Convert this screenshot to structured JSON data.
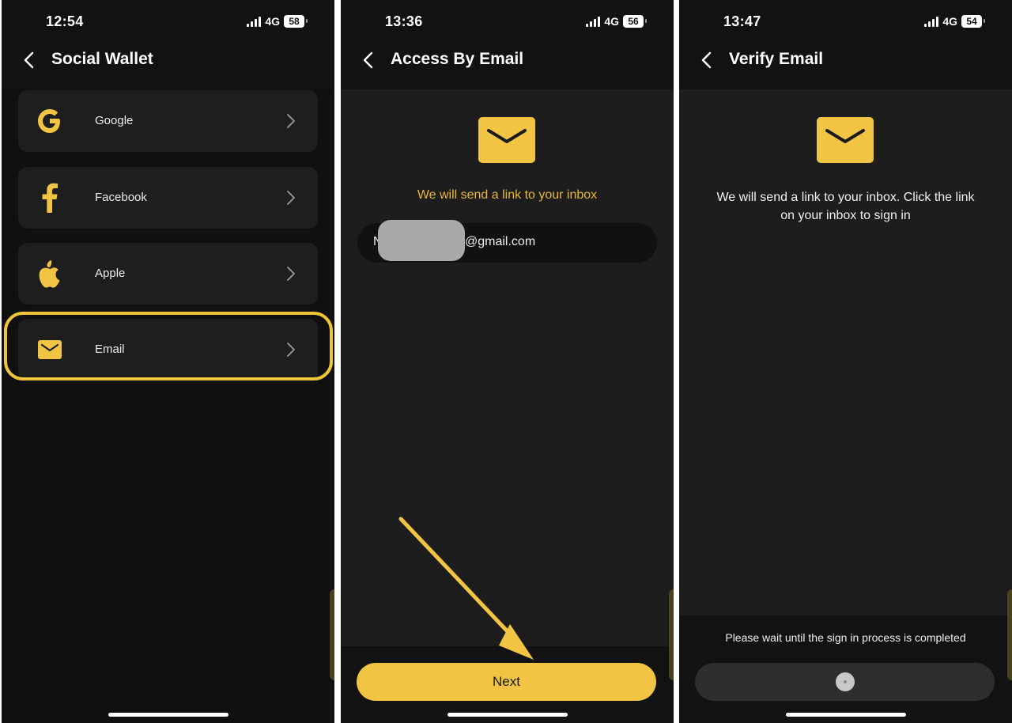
{
  "colors": {
    "accent": "#f1c443",
    "screen_bg": "#101010",
    "card_bg": "#1e1e1e",
    "hint_text": "#e8b83a"
  },
  "screens": [
    {
      "status": {
        "time": "12:54",
        "network": "4G",
        "battery": "58"
      },
      "title": "Social Wallet",
      "options": [
        {
          "label": "Google",
          "icon": "google-icon"
        },
        {
          "label": "Facebook",
          "icon": "facebook-icon"
        },
        {
          "label": "Apple",
          "icon": "apple-icon"
        },
        {
          "label": "Email",
          "icon": "email-icon",
          "highlighted": true
        }
      ]
    },
    {
      "status": {
        "time": "13:36",
        "network": "4G",
        "battery": "56"
      },
      "title": "Access By Email",
      "hint": "We will send a link to your inbox",
      "email": {
        "prefix": "N",
        "suffix": "@gmail.com"
      },
      "next_label": "Next"
    },
    {
      "status": {
        "time": "13:47",
        "network": "4G",
        "battery": "54"
      },
      "title": "Verify Email",
      "message": "We will send a link to your inbox. Click the link on your inbox to sign in",
      "wait_text": "Please wait until the sign in process is completed"
    }
  ]
}
